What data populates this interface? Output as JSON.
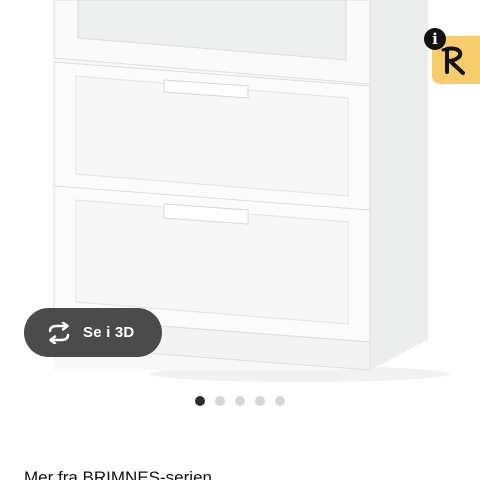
{
  "product_gallery": {
    "image_alt": "White cabinet with glass door and two drawers",
    "view_3d": {
      "label": "Se i 3D",
      "icon": "rotate-3d-icon"
    },
    "badge": {
      "info_icon": "i",
      "logo_icon": "brand-r-logo-icon",
      "logo_color": "#f6cc6d"
    },
    "carousel": {
      "total": 5,
      "active_index": 0,
      "active_color": "#2f2f2f",
      "inactive_color": "#d6d6d6"
    }
  },
  "series_link": {
    "label": "Mer fra BRIMNES-serien"
  }
}
